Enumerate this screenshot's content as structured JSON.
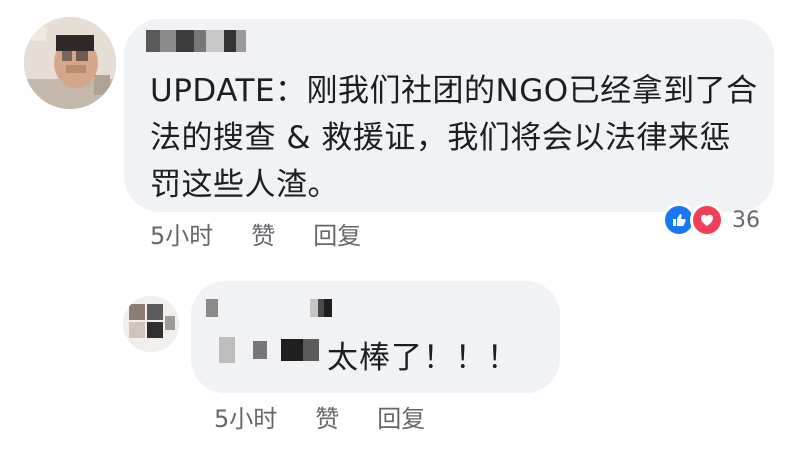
{
  "main_comment": {
    "author_name": "",
    "text": "UPDATE：刚我们社团的NGO已经拿到了合法的搜查 & 救援证，我们将会以法律来惩罚这些人渣。",
    "time": "5小时",
    "like_label": "赞",
    "reply_label": "回复",
    "reactions": {
      "count": "36",
      "icons": [
        "like-icon",
        "love-icon"
      ]
    }
  },
  "reply_comment": {
    "author_name": "",
    "text": "太棒了！！！",
    "time": "5小时",
    "like_label": "赞",
    "reply_label": "回复"
  },
  "colors": {
    "bubble_bg": "#f0f2f5",
    "meta_text": "#65676b",
    "like_blue": "#1877f2",
    "love_red": "#f33e58"
  }
}
